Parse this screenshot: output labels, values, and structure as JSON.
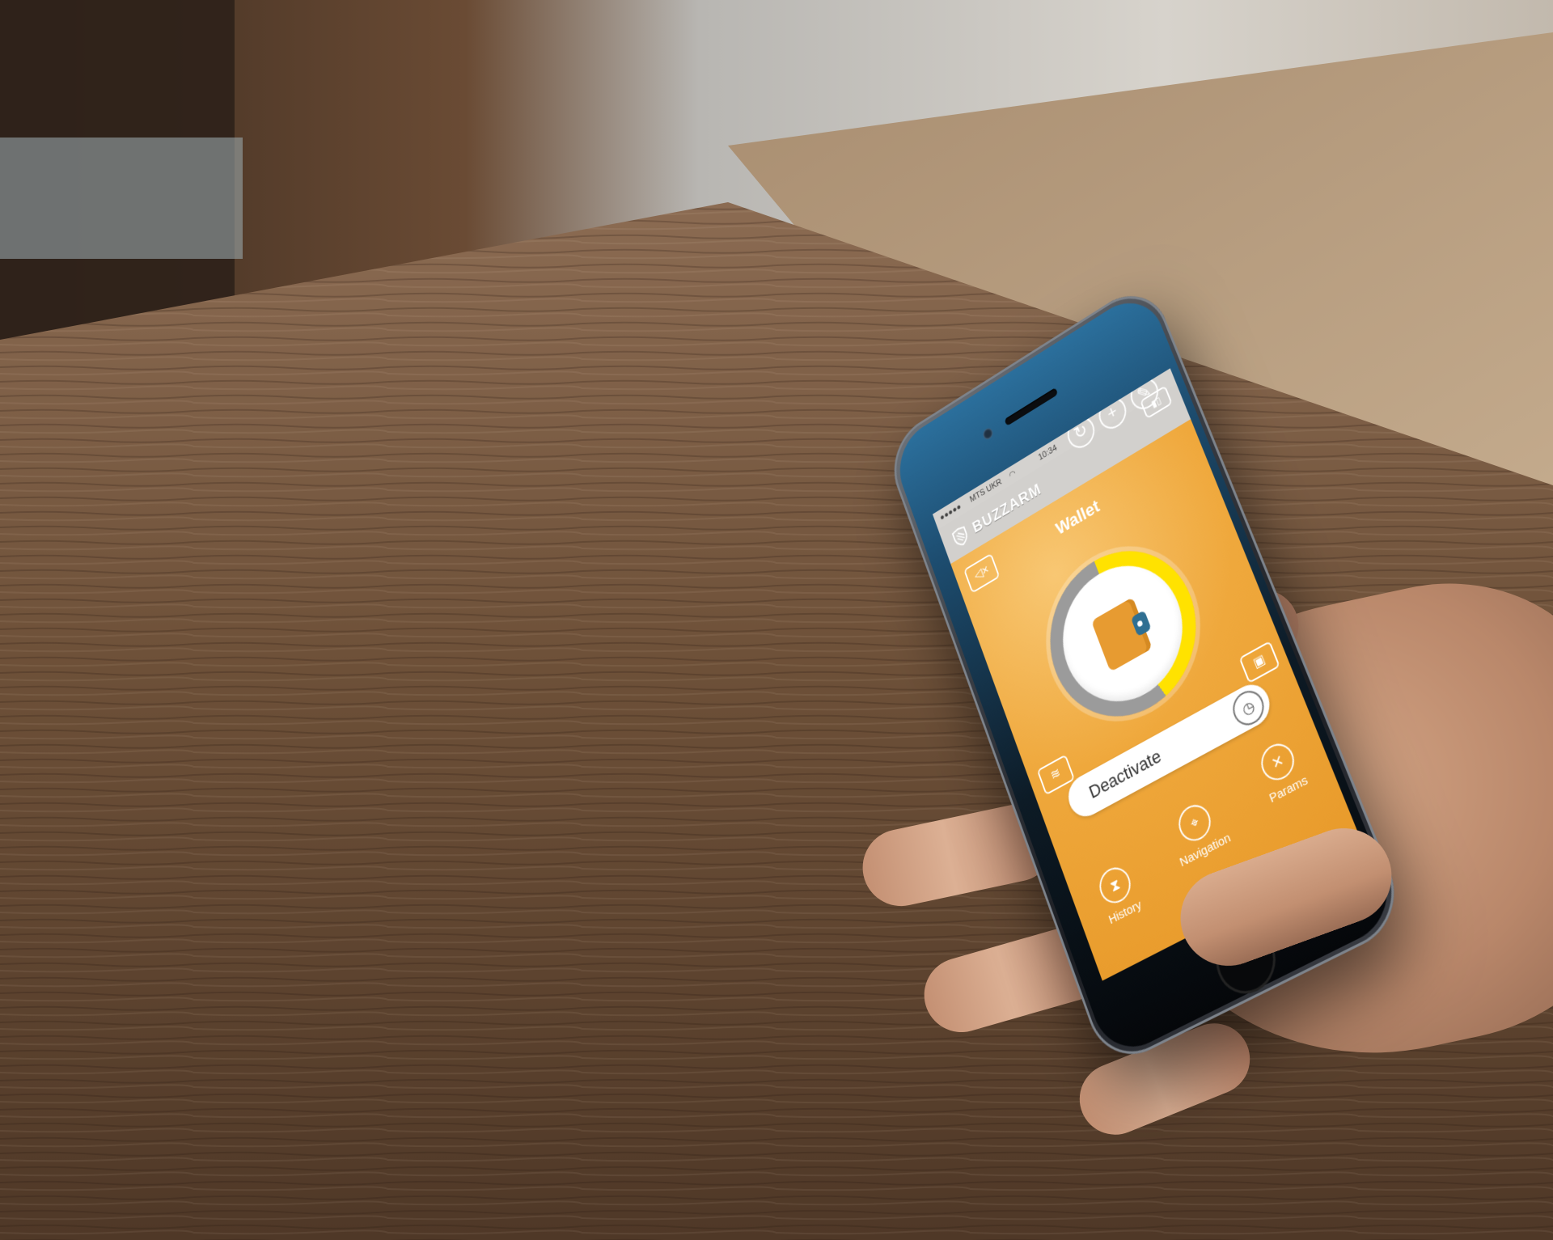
{
  "status_bar": {
    "carrier": "MTS UKR",
    "time": "10:34"
  },
  "app": {
    "brand": "BUZZARM",
    "title": "Wallet",
    "action_button": "Deactivate"
  },
  "tabs": [
    {
      "label": "History",
      "icon": "hourglass-icon"
    },
    {
      "label": "Navigation",
      "icon": "location-pin-icon"
    },
    {
      "label": "Params",
      "icon": "tools-icon"
    }
  ],
  "icons": {
    "top_buttons": [
      "refresh-icon",
      "plus-icon",
      "wrench-icon"
    ],
    "corners": [
      "battery-icon",
      "mute-icon",
      "photo-icon",
      "card-icon"
    ],
    "center": "wallet-icon",
    "timer": "stopwatch-icon"
  },
  "colors": {
    "app_orange": "#eda43a",
    "progress_yellow": "#ffe200",
    "progress_track": "#9b9b9b",
    "wood": "#6e5640"
  },
  "progress_fraction": 0.46
}
